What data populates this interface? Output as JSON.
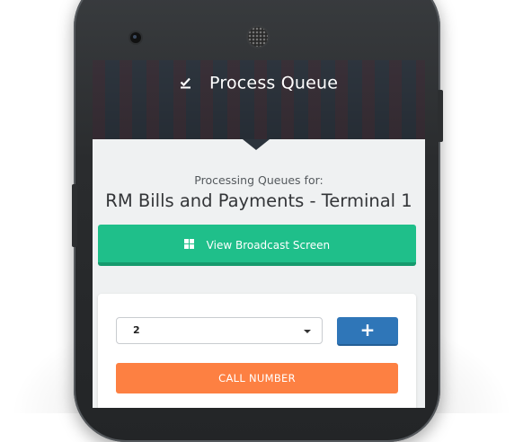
{
  "header": {
    "title": "Process Queue",
    "icon": "check-list-icon"
  },
  "queue": {
    "subtitle": "Processing Queues for:",
    "terminal_name": "RM Bills and Payments - Terminal 1"
  },
  "broadcast": {
    "label": "View Broadcast Screen",
    "icon": "grid-icon"
  },
  "controls": {
    "selected_number": "2",
    "add_label": "+",
    "call_label": "CALL NUMBER"
  },
  "colors": {
    "green": "#1fbf8a",
    "blue": "#2f76b8",
    "orange": "#fd8042",
    "header_bg": "#2b333c",
    "screen_bg": "#eff1f2"
  }
}
